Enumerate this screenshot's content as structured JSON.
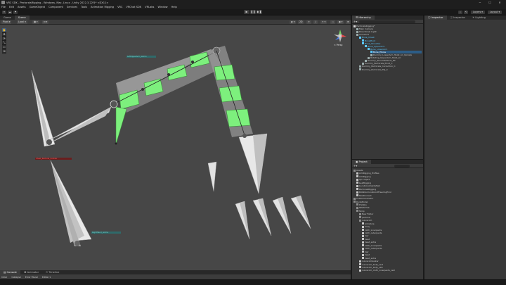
{
  "window": {
    "title": "VRC SDK - PectoralsRigging - Windows, Mac, Linux - Unity 2022.3.22f1* <DX11>",
    "controls": [
      "─",
      "☐",
      "✕"
    ]
  },
  "menu": [
    "File",
    "Edit",
    "Assets",
    "GameObject",
    "Component",
    "Services",
    "Tools",
    "Animation Rigging",
    "VRC",
    "VRChat SDK",
    "VRLabs",
    "Window",
    "Help"
  ],
  "toolbar": {
    "account_label": "▾",
    "play_icons": [
      "▶",
      "❚❚",
      "▶❚"
    ],
    "layers_label": "Layers",
    "layout_label": "Layout"
  },
  "scene": {
    "tabs": [
      "Game",
      "Scene"
    ],
    "active_tab": "Scene",
    "shading_label": "Pivot",
    "space_label": "Local",
    "persp_label": "< Persp",
    "tools": [
      "✋",
      "✥",
      "⟳",
      "⤡",
      "▭",
      "⊞"
    ],
    "bone_labels": [
      {
        "text": "LeftUpperArm_Gizmo",
        "color": "#7ed6d0"
      },
      {
        "text": "Chest_Pectoral_Collider",
        "color": "#ff6060"
      },
      {
        "text": "RightHand_Gizmo",
        "color": "#7ed6d0"
      }
    ]
  },
  "bottom": {
    "tabs": [
      "Console",
      "Animator",
      "Timeline"
    ],
    "bar_items": [
      "Clear",
      "Collapse",
      "Error Pause",
      "Editor ▾"
    ]
  },
  "hierarchy": {
    "tab_label": "Hierarchy",
    "rows": [
      {
        "text": "PectoralsRigging*",
        "indent": 0,
        "kind": "scene"
      },
      {
        "text": "Main Camera",
        "indent": 1,
        "kind": "obj"
      },
      {
        "text": "Directional Light",
        "indent": 1,
        "kind": "obj"
      },
      {
        "text": "Armature",
        "indent": 1,
        "kind": "obj"
      },
      {
        "text": "Bone_Chest",
        "indent": 2,
        "kind": "cyan"
      },
      {
        "text": "BonePivot",
        "indent": 3,
        "kind": "cyan"
      },
      {
        "text": "Bone_Shoulder",
        "indent": 3,
        "kind": "cyan"
      },
      {
        "text": "Bone_UpperArm",
        "indent": 4,
        "kind": "cyan"
      },
      {
        "text": "Bone_LowerArm",
        "indent": 5,
        "kind": "cyan"
      },
      {
        "text": "Bone_Elbow",
        "indent": 6,
        "kind": "sel"
      },
      {
        "text": "Dummy_LowerArm_Twist_LC_Update",
        "indent": 6,
        "kind": "obj"
      },
      {
        "text": "Rotating_UpperArm_Twist_LC",
        "indent": 5,
        "kind": "obj"
      },
      {
        "text": "Dummy_ShoulderBone_RC",
        "indent": 4,
        "kind": "obj"
      },
      {
        "text": "Dummy_Pectorals_Pivot_C",
        "indent": 3,
        "kind": "obj"
      },
      {
        "text": "Dummy_Pectorals_Correction_C",
        "indent": 2,
        "kind": "obj"
      },
      {
        "text": "Dummy_Pectorals_PCJ_C",
        "indent": 2,
        "kind": "obj"
      }
    ]
  },
  "project": {
    "tab_label": "Project",
    "rows": [
      {
        "text": "Assets",
        "indent": 0,
        "kind": "fold"
      },
      {
        "text": "AimRigging_Profiles",
        "indent": 1,
        "kind": "file"
      },
      {
        "text": "AimRigging",
        "indent": 1,
        "kind": "file"
      },
      {
        "text": "Ayn object",
        "indent": 1,
        "kind": "file"
      },
      {
        "text": "LeafRigging",
        "indent": 1,
        "kind": "file"
      },
      {
        "text": "LocalConstraintsTest",
        "indent": 1,
        "kind": "file"
      },
      {
        "text": "PectoralsRigging",
        "indent": 1,
        "kind": "file"
      },
      {
        "text": "RotationConstraintFreezingError",
        "indent": 1,
        "kind": "file"
      },
      {
        "text": "TwistCorrect",
        "indent": 1,
        "kind": "file"
      },
      {
        "text": "CustomAnimator",
        "indent": 0,
        "kind": "fold"
      },
      {
        "text": "DudeModel",
        "indent": 0,
        "kind": "fold"
      },
      {
        "text": "Prefabs",
        "indent": 1,
        "kind": "fold"
      },
      {
        "text": "SELECT14",
        "indent": 1,
        "kind": "fold"
      },
      {
        "text": "Temp",
        "indent": 1,
        "kind": "fold"
      },
      {
        "text": "New Folder",
        "indent": 2,
        "kind": "fold"
      },
      {
        "text": "pectoral",
        "indent": 2,
        "kind": "fold"
      },
      {
        "text": "curvecom",
        "indent": 2,
        "kind": "fold"
      },
      {
        "text": "Armature",
        "indent": 3,
        "kind": "file"
      },
      {
        "text": "body",
        "indent": 3,
        "kind": "file"
      },
      {
        "text": "cloth_innerpants",
        "indent": 3,
        "kind": "file"
      },
      {
        "text": "cloth_outerpants",
        "indent": 3,
        "kind": "file"
      },
      {
        "text": "hair",
        "indent": 3,
        "kind": "file"
      },
      {
        "text": "head",
        "indent": 3,
        "kind": "file"
      },
      {
        "text": "head_extra",
        "indent": 3,
        "kind": "file"
      },
      {
        "text": "cloth_innerpants",
        "indent": 3,
        "kind": "file"
      },
      {
        "text": "cloth_outerpants",
        "indent": 3,
        "kind": "file"
      },
      {
        "text": "hair",
        "indent": 3,
        "kind": "file"
      },
      {
        "text": "head",
        "indent": 3,
        "kind": "file"
      },
      {
        "text": "head_extra",
        "indent": 3,
        "kind": "file"
      },
      {
        "text": "curvecomAvatar",
        "indent": 2,
        "kind": "file"
      },
      {
        "text": "curvecom_body_rest",
        "indent": 2,
        "kind": "file"
      },
      {
        "text": "curvecom_body_skin",
        "indent": 2,
        "kind": "file"
      },
      {
        "text": "curvecom_cloth_innerpants_rest",
        "indent": 2,
        "kind": "file"
      }
    ]
  },
  "inspector": {
    "tabs": [
      "Inspector",
      "Inspector",
      "Lighting"
    ]
  },
  "colors": {
    "bone_green": "#7df07d",
    "bone_gray": "#9a9a9a",
    "selection_blue": "#2c5d87",
    "viewport_bg": "#474747"
  }
}
